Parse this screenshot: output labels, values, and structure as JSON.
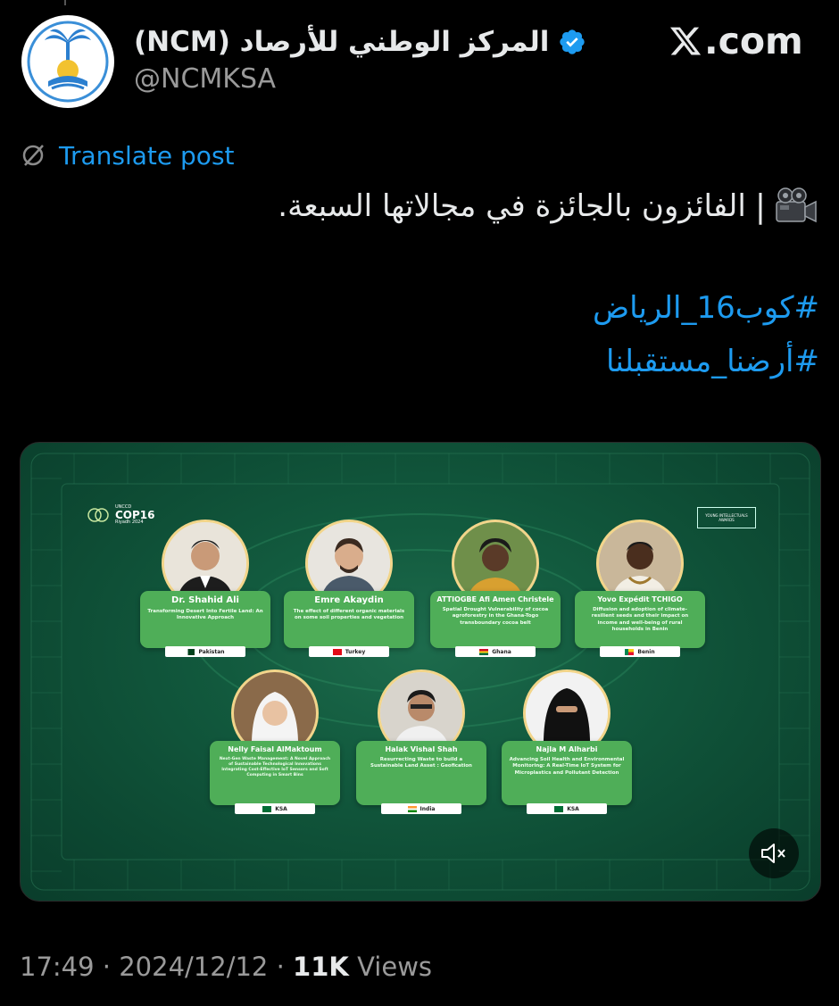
{
  "header": {
    "account_name": "المركز الوطني للأرصاد (NCM)",
    "handle": "@NCMKSA",
    "site": ".com",
    "verified_icon": "verified-badge-icon"
  },
  "translate": {
    "label": "Translate post"
  },
  "post": {
    "text": "الفائزون بالجائزة في مجالاتها السبعة.",
    "hashtags": [
      "#كوب16_الرياض",
      "#أرضنا_مستقبلنا"
    ]
  },
  "media": {
    "cop_logo": {
      "line1": "UNCCD",
      "line2": "COP16",
      "line3": "Riyadh 2024"
    },
    "right_logo": "YOUNG INTELLECTUALS AWARDS",
    "winners": [
      {
        "name": "Dr. Shahid Ali",
        "desc": "Transforming Desert Into Fertile Land: An Innovative Approach",
        "country": "Pakistan"
      },
      {
        "name": "Emre Akaydin",
        "desc": "The effect of different organic materials on some soil properties and vegetation",
        "country": "Turkey"
      },
      {
        "name": "ATTIOGBE Afi Amen Christele",
        "desc": "Spatial Drought Vulnerability of cocoa agroforestry in the Ghana-Togo transboundary cocoa belt",
        "country": "Ghana"
      },
      {
        "name": "Yovo Expédit TCHIGO",
        "desc": "Diffusion and adoption of climate-resilient seeds and their impact on income and well-being of rural households in Benin",
        "country": "Benin"
      },
      {
        "name": "Nelly Faisal AlMaktoum",
        "desc": "Next-Gen Waste Management: A Novel Approach of Sustainable Technological Innovations Integrating Cost-Effective IoT Sensors and Soft Computing in Smart Bins",
        "country": "KSA"
      },
      {
        "name": "Halak Vishal Shah",
        "desc": "Resurrecting Waste to build a Sustainable Land Asset : Geofication",
        "country": "India"
      },
      {
        "name": "Najla M Alharbi",
        "desc": "Advancing Soil Health and Environmental Monitoring: A Real-Time IoT System for Microplastics and Pollutant Detection",
        "country": "KSA"
      }
    ]
  },
  "footer": {
    "time": "17:49",
    "date": "2024/12/12",
    "views_count": "11K",
    "views_label": "Views",
    "separator": "·"
  },
  "colors": {
    "link": "#1d9bf0",
    "card": "#4fae58",
    "media_bg": "#0d4a33"
  }
}
